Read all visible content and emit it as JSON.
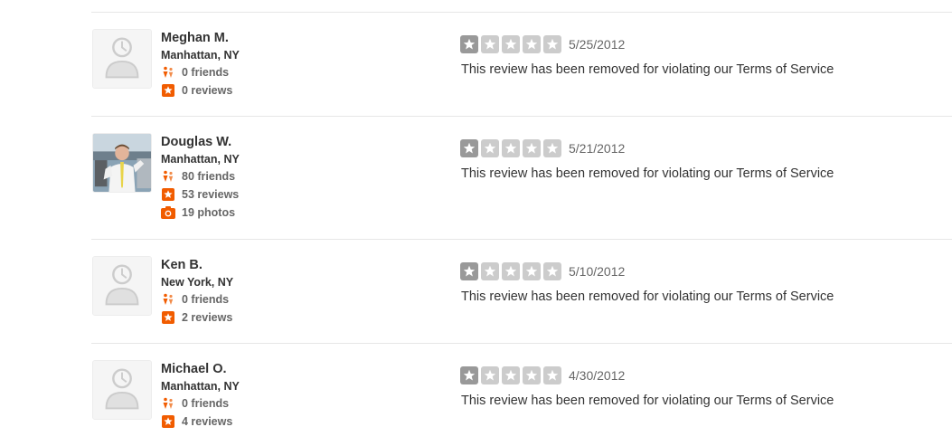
{
  "colors": {
    "star_filled": "#999999",
    "star_empty": "#cccccc",
    "accent_orange": "#f15c00",
    "friend_orange": "#f18c4b"
  },
  "reviews": [
    {
      "name": "Meghan M.",
      "location": "Manhattan, NY",
      "friends": "0 friends",
      "reviews": "0 reviews",
      "photos": null,
      "avatar": "default-avatar-icon",
      "rating": 1,
      "date": "5/25/2012",
      "text": "This review has been removed for violating our Terms of Service"
    },
    {
      "name": "Douglas W.",
      "location": "Manhattan, NY",
      "friends": "80 friends",
      "reviews": "53 reviews",
      "photos": "19 photos",
      "avatar": "user-photo",
      "rating": 1,
      "date": "5/21/2012",
      "text": "This review has been removed for violating our Terms of Service"
    },
    {
      "name": "Ken B.",
      "location": "New York, NY",
      "friends": "0 friends",
      "reviews": "2 reviews",
      "photos": null,
      "avatar": "default-avatar-icon",
      "rating": 1,
      "date": "5/10/2012",
      "text": "This review has been removed for violating our Terms of Service"
    },
    {
      "name": "Michael O.",
      "location": "Manhattan, NY",
      "friends": "0 friends",
      "reviews": "4 reviews",
      "photos": null,
      "avatar": "default-avatar-icon",
      "rating": 1,
      "date": "4/30/2012",
      "text": "This review has been removed for violating our Terms of Service"
    }
  ]
}
